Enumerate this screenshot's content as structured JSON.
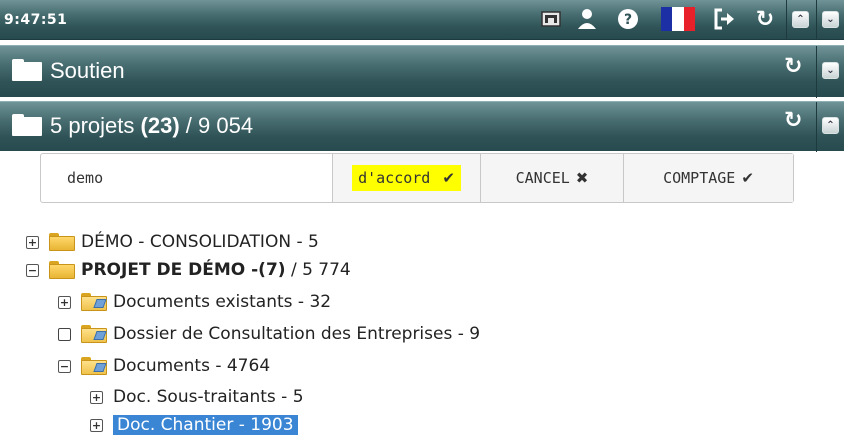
{
  "topbar": {
    "clock": "9:47:51",
    "icons": [
      "photo-icon",
      "user-icon",
      "help-icon",
      "french-flag-icon",
      "logout-icon",
      "refresh-icon",
      "collapse-all-icon",
      "expand-all-icon"
    ]
  },
  "bars": {
    "soutien": {
      "title": "Soutien"
    },
    "projects": {
      "count_label": "5 projets",
      "selected": "(23)",
      "separator": "/",
      "total": "9 054"
    }
  },
  "search": {
    "value": "demo",
    "ok_label": "d'accord",
    "cancel_label": "CANCEL",
    "count_label": "COMPTAGE"
  },
  "tree": [
    {
      "label": "DÉMO - CONSOLIDATION - 5",
      "state": "collapsed"
    },
    {
      "label_bold": "PROJET DE DÉMO - ",
      "label_bold_count": "(7)",
      "label_rest": " / 5 774",
      "state": "expanded"
    },
    {
      "label": "Documents existants - 32",
      "state": "collapsed"
    },
    {
      "label": "Dossier de Consultation des Entreprises - 9",
      "state": "leaf"
    },
    {
      "label": "Documents - 4764",
      "state": "expanded"
    },
    {
      "label": "Doc. Sous-traitants - 5",
      "state": "collapsed"
    },
    {
      "label": "Doc. Chantier - 1903",
      "state": "collapsed",
      "selected": true
    }
  ],
  "colors": {
    "bar": "#3c6266",
    "highlight": "#ffff00",
    "selection": "#3a86d4",
    "folder": "#f2c04a"
  }
}
